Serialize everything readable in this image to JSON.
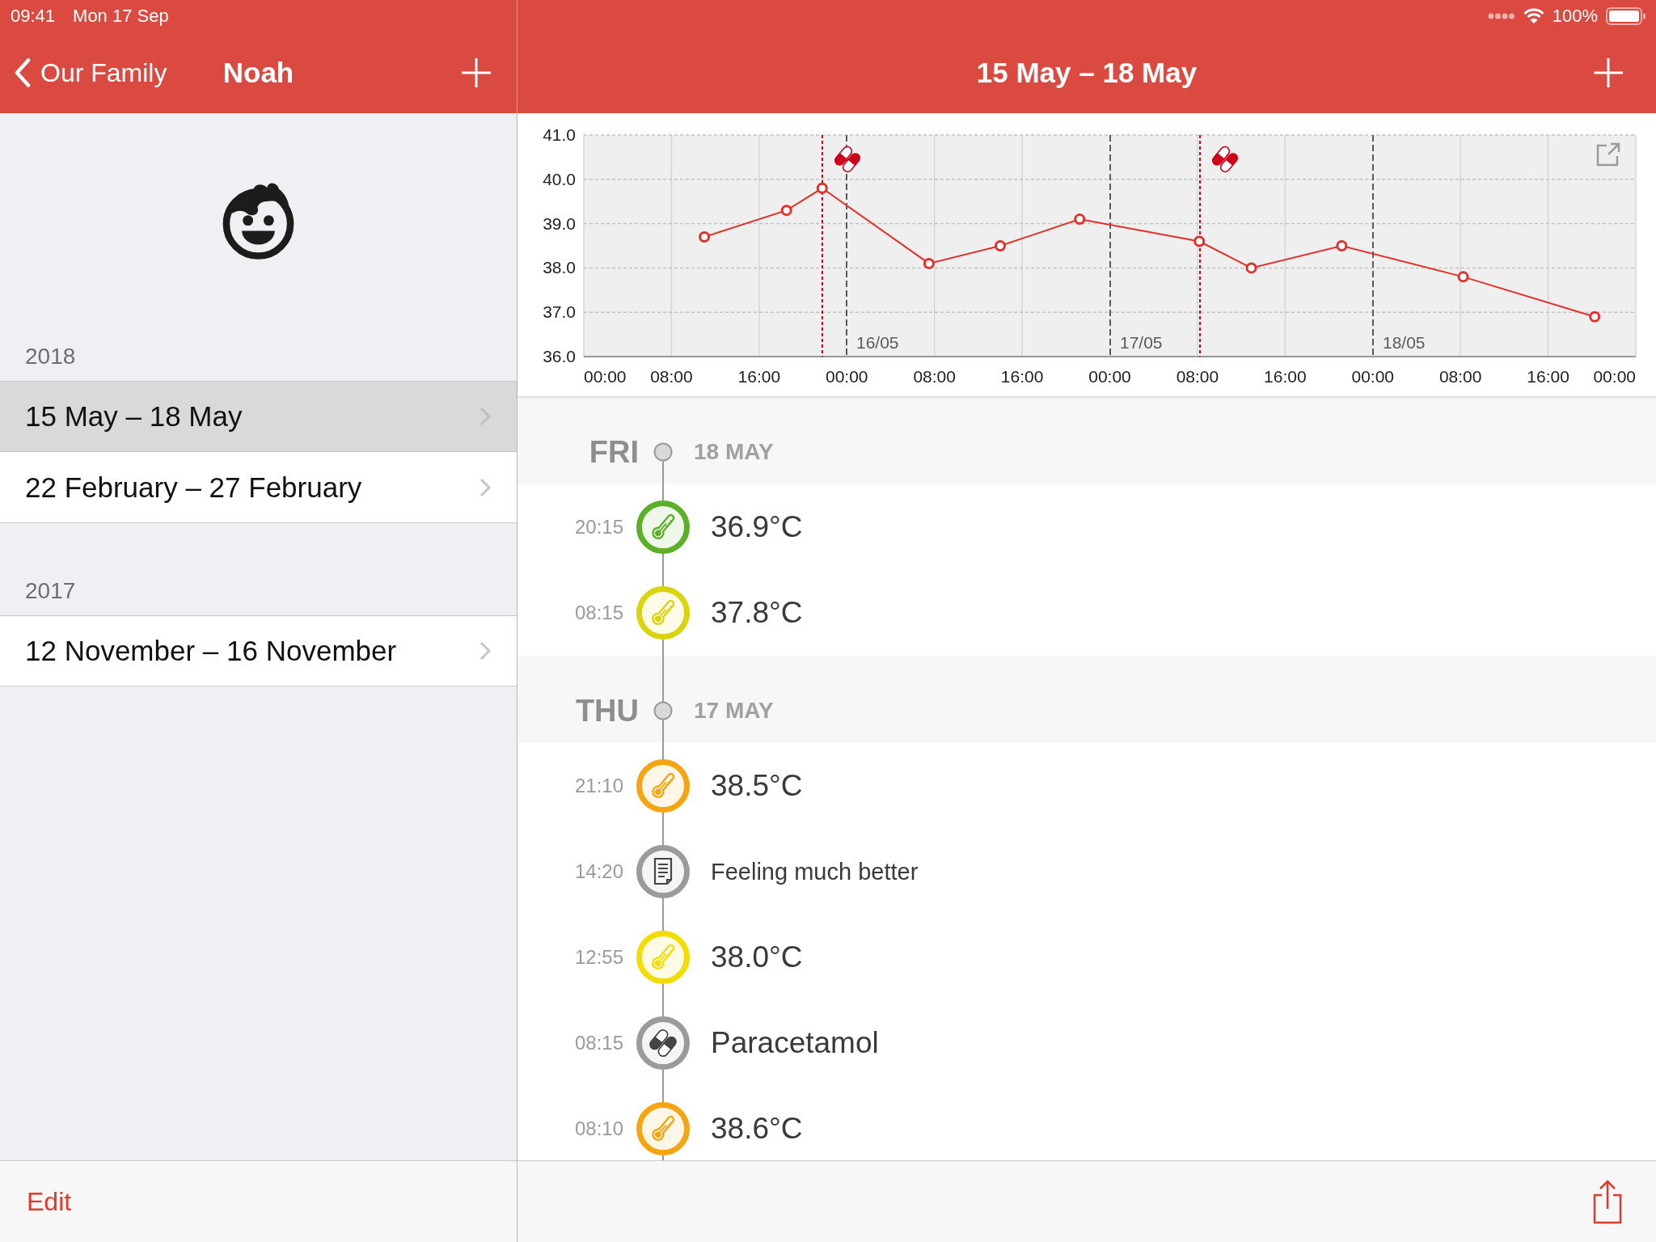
{
  "status_bar": {
    "time": "09:41",
    "date": "Mon 17 Sep",
    "battery": "100%"
  },
  "sidebar": {
    "nav": {
      "back": "Our Family",
      "title": "Noah"
    },
    "sections": [
      {
        "header": "2018",
        "items": [
          {
            "label": "15 May – 18 May",
            "selected": true
          },
          {
            "label": "22 February – 27 February",
            "selected": false
          }
        ]
      },
      {
        "header": "2017",
        "items": [
          {
            "label": "12 November – 16 November",
            "selected": false
          }
        ]
      }
    ],
    "toolbar": {
      "edit": "Edit"
    }
  },
  "detail": {
    "title": "15 May – 18 May",
    "chart_data": {
      "type": "line",
      "x": [
        "2018-05-15 11:00",
        "2018-05-15 18:30",
        "2018-05-15 21:45",
        "2018-05-16 07:30",
        "2018-05-16 14:00",
        "2018-05-16 21:15",
        "2018-05-17 08:10",
        "2018-05-17 12:55",
        "2018-05-17 21:10",
        "2018-05-18 08:15",
        "2018-05-18 20:15"
      ],
      "series": [
        {
          "color": "#e0312a",
          "marker": "o",
          "values": [
            38.7,
            39.3,
            39.8,
            38.1,
            38.5,
            39.1,
            38.6,
            38.0,
            38.5,
            37.8,
            36.9
          ]
        }
      ],
      "xlim": [
        "2018-05-15 00:00",
        "2018-05-19 00:00"
      ],
      "ylim": [
        36,
        41
      ],
      "xticks": [
        {
          "value": "2018-05-15 00:00",
          "label": "00:00"
        },
        {
          "value": "2018-05-15 08:00",
          "label": "08:00"
        },
        {
          "value": "2018-05-15 16:00",
          "label": "16:00"
        },
        {
          "value": "2018-05-16 00:00",
          "label": "00:00"
        },
        {
          "value": "2018-05-16 08:00",
          "label": "08:00"
        },
        {
          "value": "2018-05-16 16:00",
          "label": "16:00"
        },
        {
          "value": "2018-05-17 00:00",
          "label": "00:00"
        },
        {
          "value": "2018-05-17 08:00",
          "label": "08:00"
        },
        {
          "value": "2018-05-17 16:00",
          "label": "16:00"
        },
        {
          "value": "2018-05-18 00:00",
          "label": "00:00"
        },
        {
          "value": "2018-05-18 08:00",
          "label": "08:00"
        },
        {
          "value": "2018-05-18 16:00",
          "label": "16:00"
        },
        {
          "value": "2018-05-19 00:00",
          "label": "00:00"
        }
      ],
      "yticks": [
        {
          "value": 36,
          "label": "36.0"
        },
        {
          "value": 37,
          "label": "37.0"
        },
        {
          "value": 38,
          "label": "38.0"
        },
        {
          "value": 39,
          "label": "39.0"
        },
        {
          "value": 40,
          "label": "40.0"
        },
        {
          "value": 41,
          "label": "41.0"
        }
      ],
      "grid": true,
      "ref_lines": [
        {
          "axis": "x",
          "value": "2018-05-16 00:00",
          "label": "16/05",
          "color": "#5a5a5a"
        },
        {
          "axis": "x",
          "value": "2018-05-17 00:00",
          "label": "17/05",
          "color": "#5a5a5a"
        },
        {
          "axis": "x",
          "value": "2018-05-18 00:00",
          "label": "18/05",
          "color": "#5a5a5a"
        },
        {
          "axis": "x",
          "value": "2018-05-15 21:45",
          "color": "#d0021b"
        },
        {
          "axis": "x",
          "value": "2018-05-17 08:15",
          "color": "#d0021b"
        }
      ]
    },
    "days": [
      {
        "weekday": "FRI",
        "date": "18 MAY",
        "entries": [
          {
            "time": "20:15",
            "kind": "temperature",
            "text": "36.9°C",
            "color": "#5bb02a"
          },
          {
            "time": "08:15",
            "kind": "temperature",
            "text": "37.8°C",
            "color": "#d9d40c"
          }
        ]
      },
      {
        "weekday": "THU",
        "date": "17 MAY",
        "entries": [
          {
            "time": "21:10",
            "kind": "temperature",
            "text": "38.5°C",
            "color": "#f5a511"
          },
          {
            "time": "14:20",
            "kind": "note",
            "text": "Feeling much better",
            "color": "#9b9b9b"
          },
          {
            "time": "12:55",
            "kind": "temperature",
            "text": "38.0°C",
            "color": "#f5dc00"
          },
          {
            "time": "08:15",
            "kind": "medication",
            "text": "Paracetamol",
            "color": "#9b9b9b"
          },
          {
            "time": "08:10",
            "kind": "temperature",
            "text": "38.6°C",
            "color": "#f5a511"
          }
        ]
      }
    ]
  }
}
